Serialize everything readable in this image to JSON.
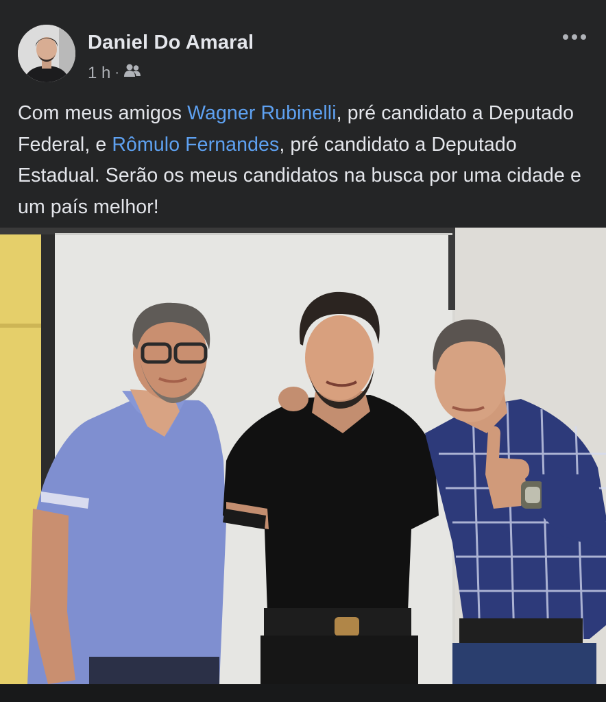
{
  "post": {
    "author": "Daniel Do Amaral",
    "time": "1 h",
    "separator": "·",
    "audience_icon": "friends-icon",
    "more_icon": "more-options-icon",
    "text_segments": [
      {
        "text": "Com meus amigos ",
        "type": "text"
      },
      {
        "text": "Wagner Rubinelli",
        "type": "mention"
      },
      {
        "text": ", pré candidato a Deputado Federal, e ",
        "type": "text"
      },
      {
        "text": "Rômulo Fernandes",
        "type": "mention"
      },
      {
        "text": ", pré candidato a Deputado Estadual. Serão os meus candidatos na busca por uma cidade e um país melhor!",
        "type": "text"
      }
    ]
  },
  "colors": {
    "background": "#242526",
    "text": "#e4e6eb",
    "secondary_text": "#b0b3b8",
    "mention": "#5ea1f1"
  }
}
